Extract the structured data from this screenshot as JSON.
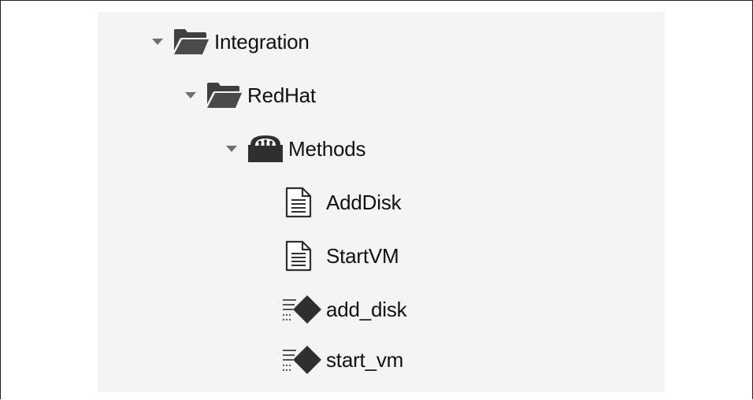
{
  "tree": {
    "nodes": [
      {
        "label": "Integration",
        "icon": "folder-open-icon",
        "expanded": true
      },
      {
        "label": "RedHat",
        "icon": "folder-open-icon",
        "expanded": true
      },
      {
        "label": "Methods",
        "icon": "methods-class-icon",
        "expanded": true
      },
      {
        "label": "AddDisk",
        "icon": "document-icon"
      },
      {
        "label": "StartVM",
        "icon": "document-icon"
      },
      {
        "label": "add_disk",
        "icon": "method-script-icon"
      },
      {
        "label": "start_vm",
        "icon": "method-script-icon"
      }
    ]
  },
  "colors": {
    "panel_background": "#f4f4f4",
    "icon": "#3a3a3a",
    "text": "#111111"
  }
}
